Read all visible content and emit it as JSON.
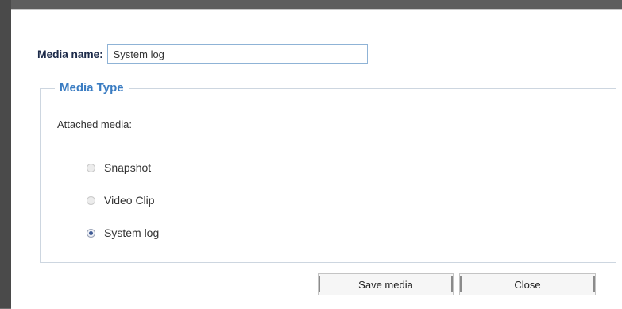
{
  "form": {
    "name_label": "Media name:",
    "name_value": "System log"
  },
  "media_type": {
    "legend": "Media Type",
    "attached_label": "Attached media:",
    "options": [
      {
        "label": "Snapshot",
        "checked": false
      },
      {
        "label": "Video Clip",
        "checked": false
      },
      {
        "label": "System log",
        "checked": true
      }
    ]
  },
  "buttons": {
    "save_label": "Save media",
    "close_label": "Close"
  }
}
